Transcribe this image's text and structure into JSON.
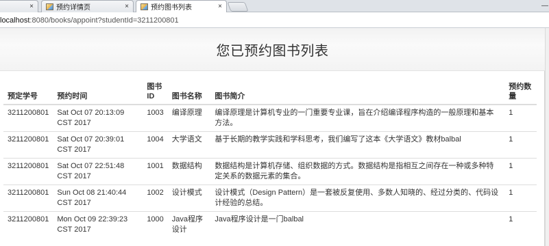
{
  "browser": {
    "tabs": [
      {
        "title": "",
        "active": false
      },
      {
        "title": "预约详情页",
        "active": false
      },
      {
        "title": "预约图书列表",
        "active": true
      }
    ],
    "close_glyph": "×",
    "minimize_glyph": "—",
    "address": {
      "host": "localhost",
      "path": ":8080/books/appoint?studentId=3211200801"
    }
  },
  "page": {
    "title": "您已预约图书列表",
    "columns": [
      "预定学号",
      "预约时间",
      "图书ID",
      "图书名称",
      "图书简介",
      "预约数量"
    ],
    "rows": [
      {
        "student_id": "3211200801",
        "appoint_time": "Sat Oct 07 20:13:09 CST 2017",
        "book_id": "1003",
        "book_name": "编译原理",
        "intro": "编译原理是计算机专业的一门重要专业课，旨在介绍编译程序构造的一般原理和基本方法。",
        "count": "1"
      },
      {
        "student_id": "3211200801",
        "appoint_time": "Sat Oct 07 20:39:01 CST 2017",
        "book_id": "1004",
        "book_name": "大学语文",
        "intro": "基于长期的教学实践和学科思考，我们编写了这本《大学语文》教材balbal",
        "count": "1"
      },
      {
        "student_id": "3211200801",
        "appoint_time": "Sat Oct 07 22:51:48 CST 2017",
        "book_id": "1001",
        "book_name": "数据结构",
        "intro": "数据结构是计算机存储、组织数据的方式。数据结构是指相互之间存在一种或多种特定关系的数据元素的集合。",
        "count": "1"
      },
      {
        "student_id": "3211200801",
        "appoint_time": "Sun Oct 08 21:40:44 CST 2017",
        "book_id": "1002",
        "book_name": "设计模式",
        "intro": "设计模式（Design Pattern）是一套被反复使用、多数人知晓的、经过分类的、代码设计经验的总结。",
        "count": "1"
      },
      {
        "student_id": "3211200801",
        "appoint_time": "Mon Oct 09 22:39:23 CST 2017",
        "book_id": "1000",
        "book_name": "Java程序设计",
        "intro": "Java程序设计是一门balbal",
        "count": "1"
      }
    ]
  }
}
